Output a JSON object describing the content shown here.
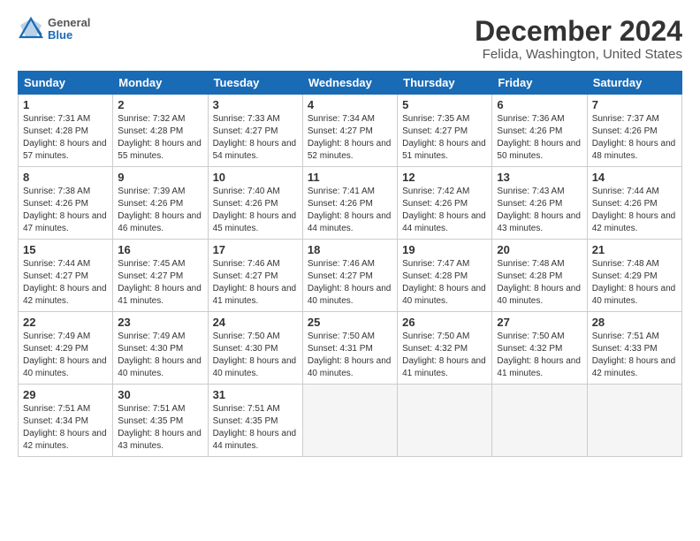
{
  "logo": {
    "line1": "General",
    "line2": "Blue"
  },
  "title": "December 2024",
  "location": "Felida, Washington, United States",
  "days_of_week": [
    "Sunday",
    "Monday",
    "Tuesday",
    "Wednesday",
    "Thursday",
    "Friday",
    "Saturday"
  ],
  "weeks": [
    [
      {
        "day": "1",
        "sunrise": "7:31 AM",
        "sunset": "4:28 PM",
        "daylight": "8 hours and 57 minutes."
      },
      {
        "day": "2",
        "sunrise": "7:32 AM",
        "sunset": "4:28 PM",
        "daylight": "8 hours and 55 minutes."
      },
      {
        "day": "3",
        "sunrise": "7:33 AM",
        "sunset": "4:27 PM",
        "daylight": "8 hours and 54 minutes."
      },
      {
        "day": "4",
        "sunrise": "7:34 AM",
        "sunset": "4:27 PM",
        "daylight": "8 hours and 52 minutes."
      },
      {
        "day": "5",
        "sunrise": "7:35 AM",
        "sunset": "4:27 PM",
        "daylight": "8 hours and 51 minutes."
      },
      {
        "day": "6",
        "sunrise": "7:36 AM",
        "sunset": "4:26 PM",
        "daylight": "8 hours and 50 minutes."
      },
      {
        "day": "7",
        "sunrise": "7:37 AM",
        "sunset": "4:26 PM",
        "daylight": "8 hours and 48 minutes."
      }
    ],
    [
      {
        "day": "8",
        "sunrise": "7:38 AM",
        "sunset": "4:26 PM",
        "daylight": "8 hours and 47 minutes."
      },
      {
        "day": "9",
        "sunrise": "7:39 AM",
        "sunset": "4:26 PM",
        "daylight": "8 hours and 46 minutes."
      },
      {
        "day": "10",
        "sunrise": "7:40 AM",
        "sunset": "4:26 PM",
        "daylight": "8 hours and 45 minutes."
      },
      {
        "day": "11",
        "sunrise": "7:41 AM",
        "sunset": "4:26 PM",
        "daylight": "8 hours and 44 minutes."
      },
      {
        "day": "12",
        "sunrise": "7:42 AM",
        "sunset": "4:26 PM",
        "daylight": "8 hours and 44 minutes."
      },
      {
        "day": "13",
        "sunrise": "7:43 AM",
        "sunset": "4:26 PM",
        "daylight": "8 hours and 43 minutes."
      },
      {
        "day": "14",
        "sunrise": "7:44 AM",
        "sunset": "4:26 PM",
        "daylight": "8 hours and 42 minutes."
      }
    ],
    [
      {
        "day": "15",
        "sunrise": "7:44 AM",
        "sunset": "4:27 PM",
        "daylight": "8 hours and 42 minutes."
      },
      {
        "day": "16",
        "sunrise": "7:45 AM",
        "sunset": "4:27 PM",
        "daylight": "8 hours and 41 minutes."
      },
      {
        "day": "17",
        "sunrise": "7:46 AM",
        "sunset": "4:27 PM",
        "daylight": "8 hours and 41 minutes."
      },
      {
        "day": "18",
        "sunrise": "7:46 AM",
        "sunset": "4:27 PM",
        "daylight": "8 hours and 40 minutes."
      },
      {
        "day": "19",
        "sunrise": "7:47 AM",
        "sunset": "4:28 PM",
        "daylight": "8 hours and 40 minutes."
      },
      {
        "day": "20",
        "sunrise": "7:48 AM",
        "sunset": "4:28 PM",
        "daylight": "8 hours and 40 minutes."
      },
      {
        "day": "21",
        "sunrise": "7:48 AM",
        "sunset": "4:29 PM",
        "daylight": "8 hours and 40 minutes."
      }
    ],
    [
      {
        "day": "22",
        "sunrise": "7:49 AM",
        "sunset": "4:29 PM",
        "daylight": "8 hours and 40 minutes."
      },
      {
        "day": "23",
        "sunrise": "7:49 AM",
        "sunset": "4:30 PM",
        "daylight": "8 hours and 40 minutes."
      },
      {
        "day": "24",
        "sunrise": "7:50 AM",
        "sunset": "4:30 PM",
        "daylight": "8 hours and 40 minutes."
      },
      {
        "day": "25",
        "sunrise": "7:50 AM",
        "sunset": "4:31 PM",
        "daylight": "8 hours and 40 minutes."
      },
      {
        "day": "26",
        "sunrise": "7:50 AM",
        "sunset": "4:32 PM",
        "daylight": "8 hours and 41 minutes."
      },
      {
        "day": "27",
        "sunrise": "7:50 AM",
        "sunset": "4:32 PM",
        "daylight": "8 hours and 41 minutes."
      },
      {
        "day": "28",
        "sunrise": "7:51 AM",
        "sunset": "4:33 PM",
        "daylight": "8 hours and 42 minutes."
      }
    ],
    [
      {
        "day": "29",
        "sunrise": "7:51 AM",
        "sunset": "4:34 PM",
        "daylight": "8 hours and 42 minutes."
      },
      {
        "day": "30",
        "sunrise": "7:51 AM",
        "sunset": "4:35 PM",
        "daylight": "8 hours and 43 minutes."
      },
      {
        "day": "31",
        "sunrise": "7:51 AM",
        "sunset": "4:35 PM",
        "daylight": "8 hours and 44 minutes."
      },
      null,
      null,
      null,
      null
    ]
  ]
}
